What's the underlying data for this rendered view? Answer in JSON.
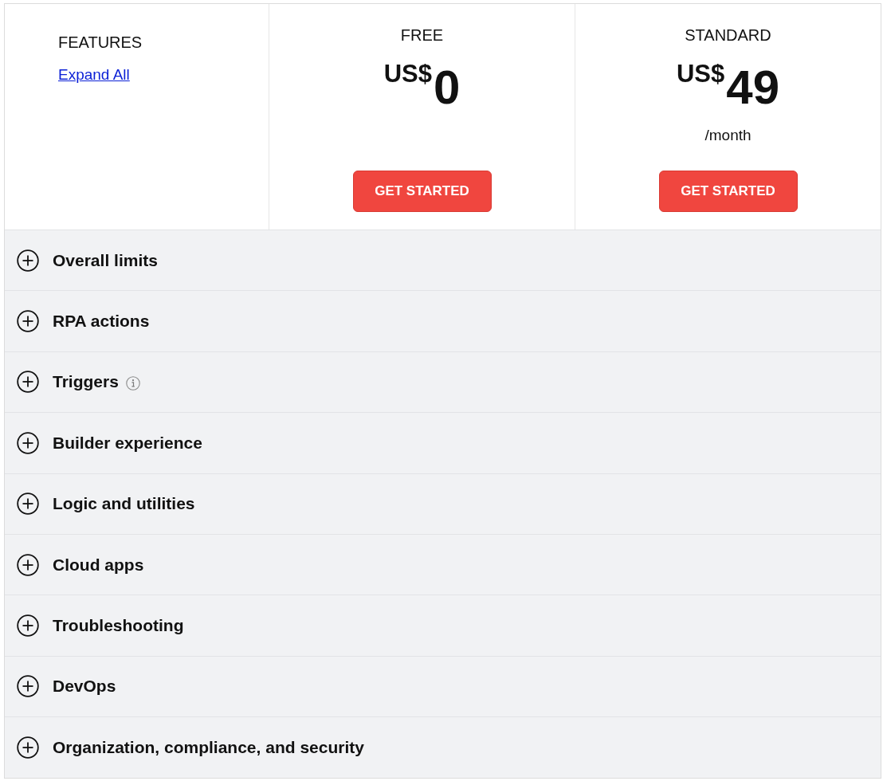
{
  "features_header": {
    "title": "FEATURES",
    "expand_link": "Expand All"
  },
  "plans": [
    {
      "name": "FREE",
      "currency": "US$",
      "amount": "0",
      "button": "GET STARTED"
    },
    {
      "name": "STANDARD",
      "currency": "US$",
      "amount": "49",
      "period": "/month",
      "button": "GET STARTED"
    }
  ],
  "feature_groups": [
    {
      "label": "Overall limits",
      "expanded": false,
      "info": false
    },
    {
      "label": "RPA actions",
      "expanded": false,
      "info": false
    },
    {
      "label": "Triggers",
      "expanded": false,
      "info": true
    },
    {
      "label": "Builder experience",
      "expanded": false,
      "info": false
    },
    {
      "label": "Logic and utilities",
      "expanded": false,
      "info": false
    },
    {
      "label": "Cloud apps",
      "expanded": false,
      "info": false
    },
    {
      "label": "Troubleshooting",
      "expanded": false,
      "info": false
    },
    {
      "label": "DevOps",
      "expanded": false,
      "info": false
    },
    {
      "label": "Organization, compliance, and security",
      "expanded": false,
      "info": false
    }
  ]
}
